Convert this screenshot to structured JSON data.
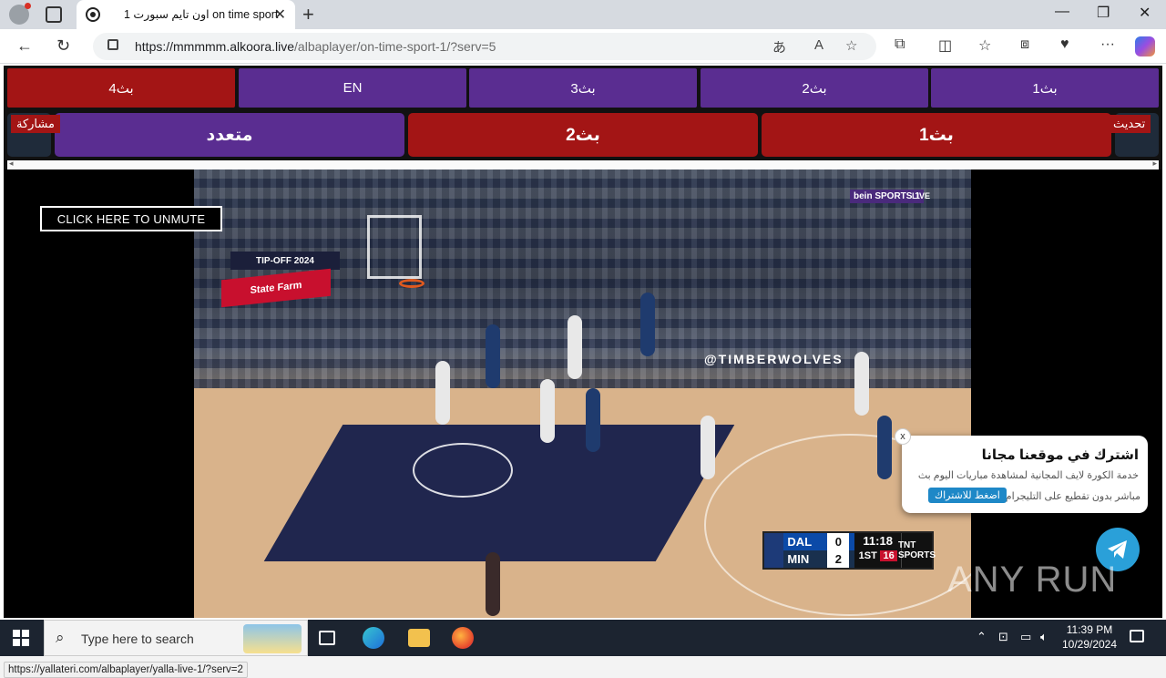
{
  "browser": {
    "tab_title": "اون تايم سبورت 1 on time sport",
    "url_host": "https://mmmmm.alkoora.live",
    "url_path": "/albaplayer/on-time-sport-1/?serv=5"
  },
  "servers": [
    {
      "label": "بث4",
      "active": true
    },
    {
      "label": "EN",
      "active": false
    },
    {
      "label": "بث3",
      "active": false
    },
    {
      "label": "بث2",
      "active": false
    },
    {
      "label": "بث1",
      "active": false
    }
  ],
  "big_buttons": [
    {
      "label": "متعدد",
      "color": "#5a2d91"
    },
    {
      "label": "بث2",
      "color": "#a31515"
    },
    {
      "label": "بث1",
      "color": "#a31515"
    }
  ],
  "share_label": "مشاركة",
  "refresh_label": "تحديث",
  "video": {
    "unmute_label": "CLICK HERE TO UNMUTE",
    "bein_label": "bein SPORTS 1",
    "live_label": "LIVE",
    "ad_text": "State Farm",
    "tipoff_text": "TIP-OFF 2024",
    "wall_text": "@TIMBERWOLVES",
    "scorebug": {
      "team1": "DAL",
      "score1": "0",
      "team2": "MIN",
      "score2": "2",
      "clock": "11:18",
      "quarter": "1ST",
      "shot_clock": "16",
      "network": "TNT SPORTS"
    }
  },
  "popup": {
    "title": "اشترك في موقعنا مجانا",
    "desc_line1": "خدمة الكورة لايف المجانية لمشاهدة مباريات اليوم بث",
    "desc_line2": "مباشر بدون تقطيع على التليجرام",
    "button_label": "اضغط للاشتراك",
    "close_label": "x"
  },
  "watermark": "ANY RUN",
  "status_url": "https://yallateri.com/albaplayer/yalla-live-1/?serv=2",
  "taskbar": {
    "search_placeholder": "Type here to search",
    "time": "11:39 PM",
    "date": "10/29/2024"
  }
}
